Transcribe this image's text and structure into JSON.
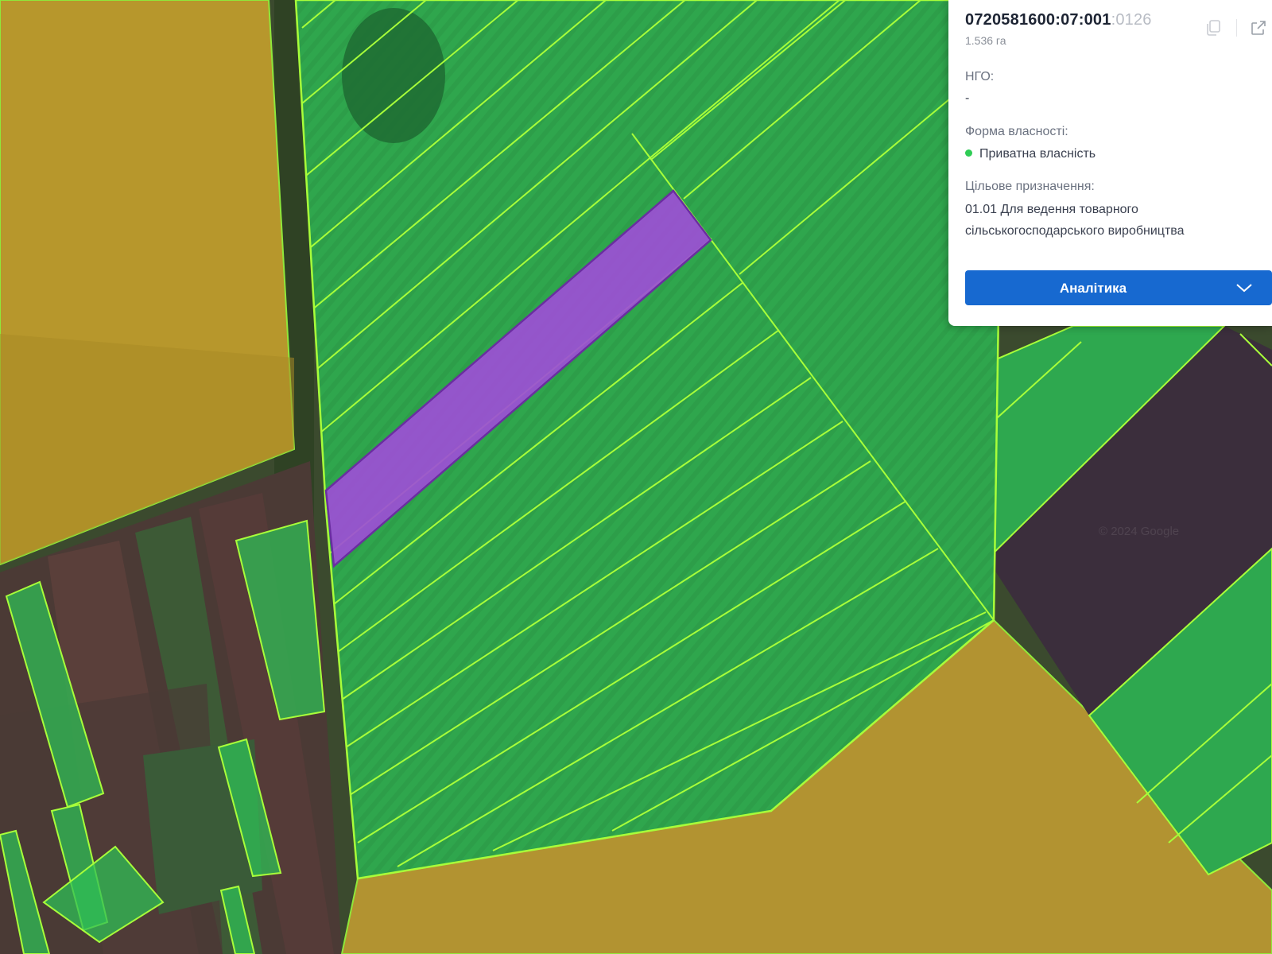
{
  "map": {
    "watermark": "© 2024 Google",
    "selected_parcel_color": "#9d4fd6",
    "parcel_border_color": "#a8ff3a",
    "green_parcel_fill": "#2fd35a",
    "yellow_field_color": "#b99a2a"
  },
  "panel": {
    "cadastral_number_main": "0720581600:07:001",
    "cadastral_number_tail": ":0126",
    "area": "1.536 га",
    "ngo": {
      "label": "НГО:",
      "value": "-"
    },
    "ownership": {
      "label": "Форма власності:",
      "value": "Приватна власність",
      "status_color": "#2fcc55"
    },
    "purpose": {
      "label": "Цільове призначення:",
      "line1": "01.01 Для ведення товарного",
      "line2": "сільськогосподарського виробництва"
    },
    "analytics_button": "Аналітика",
    "icons": {
      "copy": "copy-icon",
      "open": "external-link-icon",
      "dropdown": "chevron-down-icon"
    }
  }
}
